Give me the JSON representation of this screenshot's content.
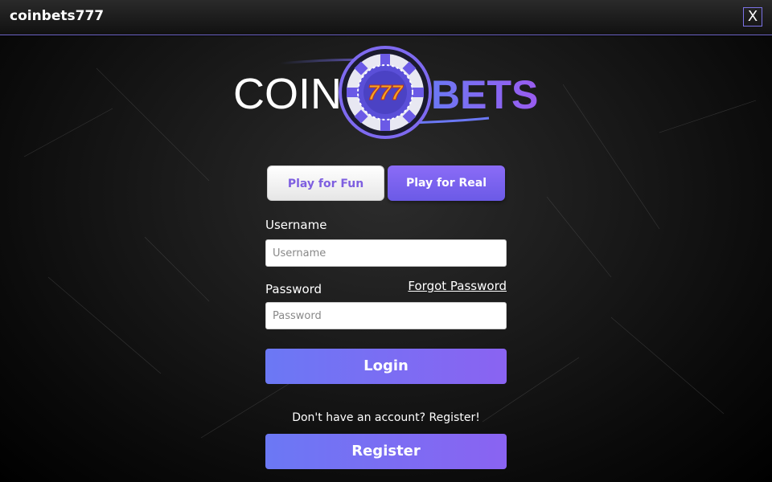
{
  "window": {
    "title": "coinbets777",
    "close_label": "X"
  },
  "logo": {
    "word_left": "COIN",
    "chip_text": "777",
    "word_right": "BETS"
  },
  "mode": {
    "fun_label": "Play for Fun",
    "real_label": "Play for Real"
  },
  "login": {
    "username_label": "Username",
    "username_placeholder": "Username",
    "password_label": "Password",
    "password_placeholder": "Password",
    "forgot_label": "Forgot Password",
    "login_label": "Login"
  },
  "register": {
    "prompt": "Don't have an account? Register!",
    "button_label": "Register"
  },
  "colors": {
    "accent": "#7b6cf0",
    "accent_dark": "#6b5ae6",
    "chip_orange": "#f5a623"
  }
}
